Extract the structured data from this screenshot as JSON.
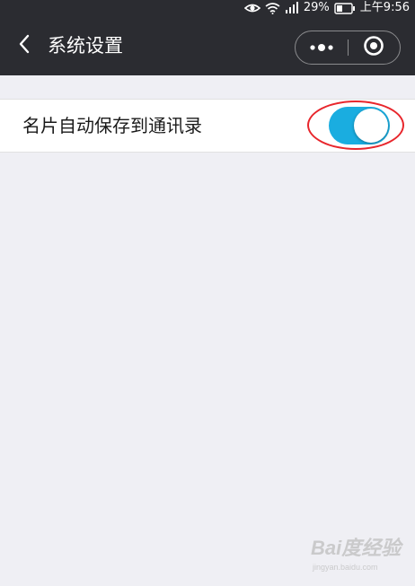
{
  "status_bar": {
    "battery": "29%",
    "time": "上午9:56",
    "icons": [
      "eye-icon",
      "wifi-icon",
      "signal-icon",
      "battery-icon"
    ]
  },
  "nav": {
    "title": "系统设置",
    "back_icon": "chevron-left-icon",
    "more_icon": "more-dots-icon",
    "close_icon": "target-circle-icon",
    "background": "#2b2c31"
  },
  "settings": {
    "items": [
      {
        "label": "名片自动保存到通讯录",
        "enabled": true
      }
    ]
  },
  "colors": {
    "page_bg": "#efeff4",
    "toggle_on": "#1aade0",
    "annotation": "#e8262c"
  },
  "watermark": {
    "mark": "Bai度经验",
    "sub": "jingyan.baidu.com"
  }
}
